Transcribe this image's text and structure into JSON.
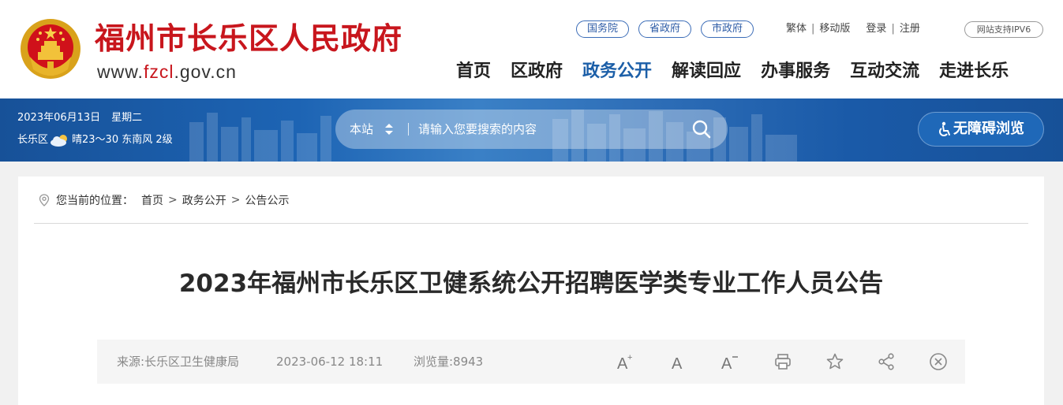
{
  "header": {
    "site_title": "福州市长乐区人民政府",
    "url_prefix": "www.",
    "url_highlight": "fzcl",
    "url_suffix": ".gov.cn",
    "gov_links": [
      "国务院",
      "省政府",
      "市政府"
    ],
    "util_links": {
      "traditional": "繁体",
      "mobile": "移动版",
      "login": "登录",
      "register": "注册"
    },
    "ipv6_badge": "网站支持IPV6",
    "nav": [
      {
        "label": "首页",
        "active": false
      },
      {
        "label": "区政府",
        "active": false
      },
      {
        "label": "政务公开",
        "active": true
      },
      {
        "label": "解读回应",
        "active": false
      },
      {
        "label": "办事服务",
        "active": false
      },
      {
        "label": "互动交流",
        "active": false
      },
      {
        "label": "走进长乐",
        "active": false
      }
    ],
    "colors": {
      "brand_red": "#c8161d",
      "nav_active": "#1c5fa8"
    }
  },
  "banner": {
    "date": "2023年06月13日",
    "weekday": "星期二",
    "region": "长乐区",
    "weather_icon": "cloud-sun-icon",
    "weather": "晴23～30 东南风 2级",
    "search": {
      "scope": "本站",
      "placeholder": "请输入您要搜索的内容"
    },
    "accessibility_label": "无障碍浏览",
    "colors": {
      "banner_blue": "#1d64b4"
    }
  },
  "breadcrumb": {
    "prefix": "您当前的位置：",
    "items": [
      "首页",
      "政务公开",
      "公告公示"
    ],
    "separator": ">"
  },
  "article": {
    "title": "2023年福州市长乐区卫健系统公开招聘医学类专业工作人员公告",
    "source": "来源:长乐区卫生健康局",
    "datetime": "2023-06-12 18:11",
    "views": "浏览量:8943",
    "tools": [
      "font-increase-icon",
      "font-normal-icon",
      "font-decrease-icon",
      "print-icon",
      "star-icon",
      "share-icon",
      "close-icon"
    ]
  }
}
